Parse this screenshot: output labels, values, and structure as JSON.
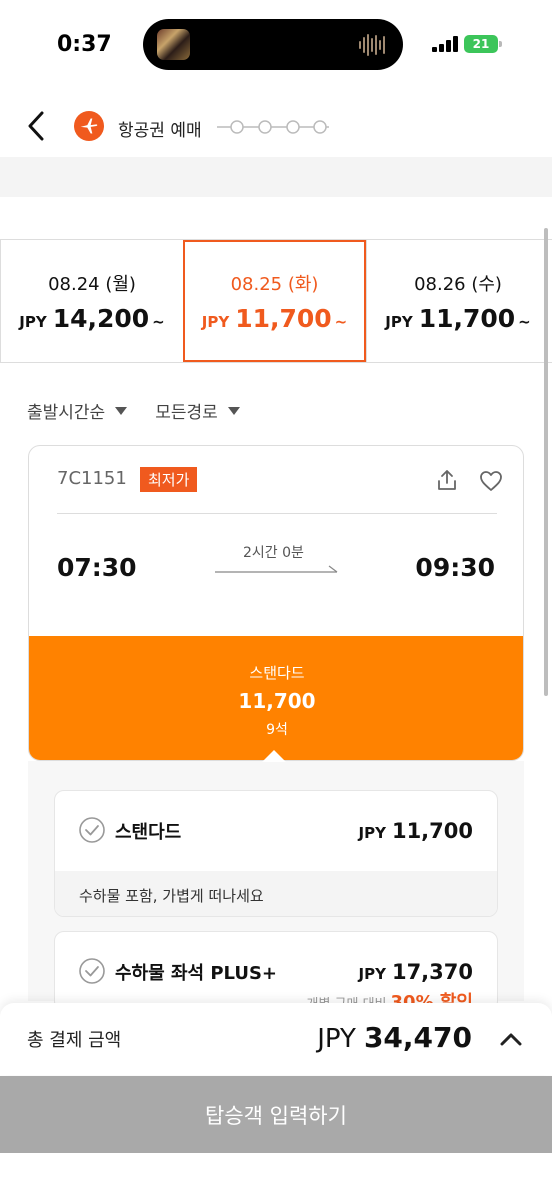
{
  "status_bar": {
    "time": "0:37",
    "battery": "21"
  },
  "header": {
    "title": "항공권 예매"
  },
  "date_tabs": [
    {
      "date": "08.24 (월)",
      "currency": "JPY",
      "price": "14,200",
      "suffix": "~"
    },
    {
      "date": "08.25 (화)",
      "currency": "JPY",
      "price": "11,700",
      "suffix": "~"
    },
    {
      "date": "08.26 (수)",
      "currency": "JPY",
      "price": "11,700",
      "suffix": "~"
    }
  ],
  "filters": {
    "sort": "출발시간순",
    "route": "모든경로"
  },
  "flight": {
    "number": "7C1151",
    "badge": "최저가",
    "duration": "2시간 0분",
    "departure": "07:30",
    "arrival": "09:30",
    "fare": {
      "name": "스탠다드",
      "price": "11,700",
      "seats": "9석"
    }
  },
  "options": [
    {
      "name": "스탠다드",
      "currency": "JPY",
      "price": "11,700",
      "description": "수하물 포함, 가볍게 떠나세요"
    },
    {
      "name": "수하물 좌석 PLUS+",
      "currency": "JPY",
      "price": "17,370",
      "discount_prefix": "개별 구매 대비",
      "discount": "30% 할인"
    }
  ],
  "bottom": {
    "total_label": "총 결제 금액",
    "currency": "JPY",
    "total": "34,470",
    "cta": "탑승객 입력하기"
  },
  "colors": {
    "accent": "#f05a1e",
    "fare_panel": "#ff8200",
    "cta_disabled": "#a9a9a9"
  }
}
